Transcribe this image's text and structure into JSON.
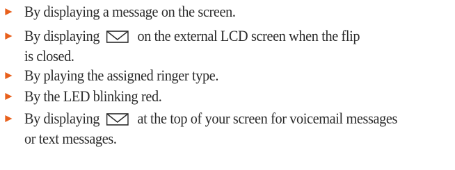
{
  "colors": {
    "bullet": "#e8601c",
    "text": "#2a2a2a"
  },
  "list": {
    "items": [
      {
        "text": "By displaying a message on the screen."
      },
      {
        "before": "By displaying",
        "icon": "envelope-icon",
        "after": "on the external LCD screen when the flip",
        "continuation": "is closed."
      },
      {
        "text": "By playing the assigned ringer type."
      },
      {
        "text": "By the LED blinking red."
      },
      {
        "before": "By displaying",
        "icon": "envelope-icon",
        "after": "at the top of your screen for voicemail messages",
        "continuation": "or text messages."
      }
    ]
  }
}
